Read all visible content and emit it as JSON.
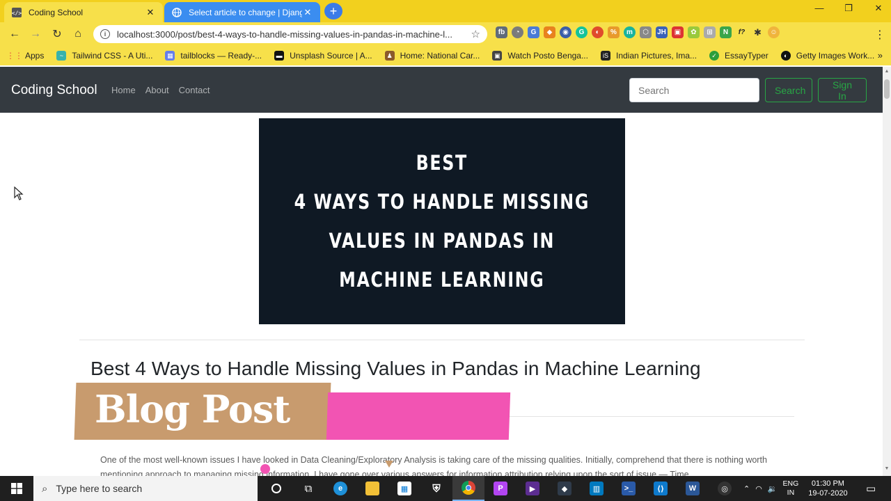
{
  "browser": {
    "tabs": [
      {
        "title": "Coding School",
        "favicon": "code-icon",
        "active": true
      },
      {
        "title": "Select article to change | Django",
        "favicon": "globe-icon",
        "active": false
      }
    ],
    "new_tab": "+",
    "window_controls": [
      "—",
      "❐",
      "✕"
    ],
    "url": "localhost:3000/post/best-4-ways-to-handle-missing-values-in-pandas-in-machine-l...",
    "bookmarks": [
      {
        "label": "Apps",
        "color": "#e74c3c"
      },
      {
        "label": "Tailwind CSS - A Uti...",
        "color": "#38b2ac"
      },
      {
        "label": "tailblocks — Ready-...",
        "color": "#667eea"
      },
      {
        "label": "Unsplash Source | A...",
        "color": "#111111"
      },
      {
        "label": "Home: National Car...",
        "color": "#8b5a2b"
      },
      {
        "label": "Watch Posto Benga...",
        "color": "#444444"
      },
      {
        "label": "Indian Pictures, Ima...",
        "color": "#222222"
      },
      {
        "label": "EssayTyper",
        "color": "#2e9e3a"
      },
      {
        "label": "Getty Images Work...",
        "color": "#111111"
      }
    ]
  },
  "site": {
    "brand": "Coding School",
    "nav": [
      "Home",
      "About",
      "Contact"
    ],
    "search_placeholder": "Search",
    "search_button": "Search",
    "signin_button": "Sign In"
  },
  "post": {
    "hero_lines": [
      "BEST",
      "4 WAYS TO HANDLE MISSING",
      "VALUES IN PANDAS IN",
      "MACHINE LEARNING"
    ],
    "title": "Best 4 Ways to Handle Missing Values in Pandas in Machine Learning",
    "banner": "Blog Post",
    "body": "One of the most well-known issues I have looked in Data Cleaning/Exploratory Analysis is taking care of the missing qualities. Initially, comprehend that there is nothing worth mentioning approach to managing missing information. I have gone over various answers for information attribution relying upon the sort of issue — Time"
  },
  "taskbar": {
    "search_placeholder": "Type here to search",
    "lang_top": "ENG",
    "lang_bottom": "IN",
    "time": "01:30 PM",
    "date": "19-07-2020"
  },
  "colors": {
    "chrome_yellow": "#f7e04a",
    "nav_dark": "#343a40",
    "success_green": "#28a745",
    "hero_bg": "#0f1924",
    "banner_tan": "#c89b6e",
    "banner_pink": "#f254b3"
  }
}
